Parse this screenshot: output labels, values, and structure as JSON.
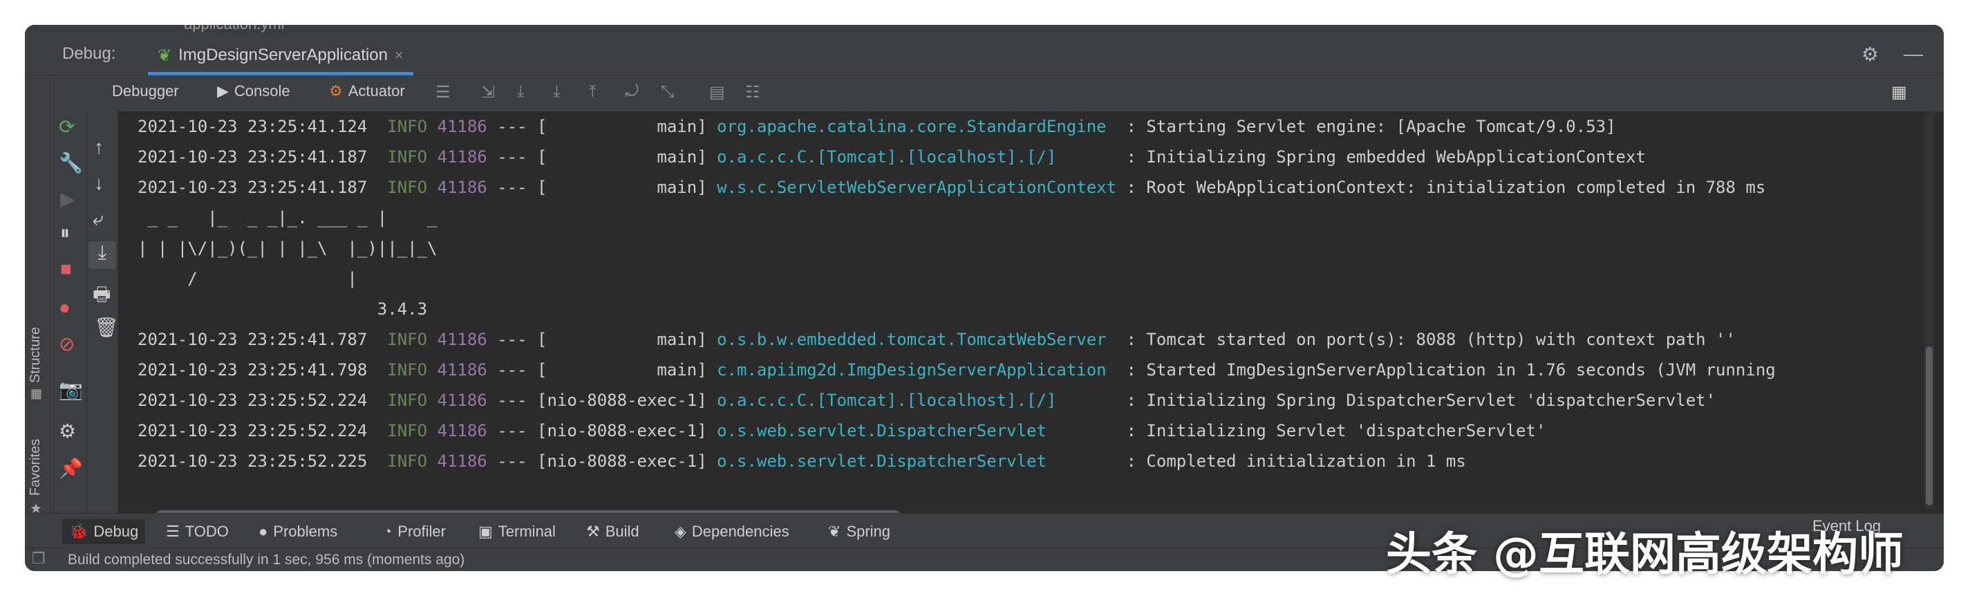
{
  "window": {
    "top_file": "application.yml",
    "debug_label": "Debug:",
    "run_config_tab": "ImgDesignServerApplication",
    "tab_close": "×"
  },
  "toolbar": {
    "debugger_label": "Debugger",
    "console_label": "Console",
    "actuator_label": "Actuator"
  },
  "left_sidebar": {
    "structure_label": "Structure",
    "favorites_label": "Favorites"
  },
  "console_lines": [
    {
      "ts": "2021-10-23 23:25:41.124",
      "level": "INFO",
      "pid": "41186",
      "sep": "---",
      "thread": "[           main]",
      "logger": "org.apache.catalina.core.StandardEngine ",
      "msg": ": Starting Servlet engine: [Apache Tomcat/9.0.53]"
    },
    {
      "ts": "2021-10-23 23:25:41.187",
      "level": "INFO",
      "pid": "41186",
      "sep": "---",
      "thread": "[           main]",
      "logger": "o.a.c.c.C.[Tomcat].[localhost].[/]      ",
      "msg": ": Initializing Spring embedded WebApplicationContext"
    },
    {
      "ts": "2021-10-23 23:25:41.187",
      "level": "INFO",
      "pid": "41186",
      "sep": "---",
      "thread": "[           main]",
      "logger": "w.s.c.ServletWebServerApplicationContext",
      "msg": ": Root WebApplicationContext: initialization completed in 788 ms"
    }
  ],
  "banner": {
    "line1": " _ _   |_  _ _|_. ___ _ |    _",
    "line2": "| | |\\/|_)(_| | |_\\  |_)||_|_\\",
    "line3": "     /               |",
    "version": "                        3.4.3"
  },
  "console_lines_after": [
    {
      "ts": "2021-10-23 23:25:41.787",
      "level": "INFO",
      "pid": "41186",
      "sep": "---",
      "thread": "[           main]",
      "logger": "o.s.b.w.embedded.tomcat.TomcatWebServer ",
      "msg": ": Tomcat started on port(s): 8088 (http) with context path ''"
    },
    {
      "ts": "2021-10-23 23:25:41.798",
      "level": "INFO",
      "pid": "41186",
      "sep": "---",
      "thread": "[           main]",
      "logger": "c.m.apiimg2d.ImgDesignServerApplication ",
      "msg": ": Started ImgDesignServerApplication in 1.76 seconds (JVM running"
    },
    {
      "ts": "2021-10-23 23:25:52.224",
      "level": "INFO",
      "pid": "41186",
      "sep": "---",
      "thread": "[nio-8088-exec-1]",
      "logger": "o.a.c.c.C.[Tomcat].[localhost].[/]      ",
      "msg": ": Initializing Spring DispatcherServlet 'dispatcherServlet'"
    },
    {
      "ts": "2021-10-23 23:25:52.224",
      "level": "INFO",
      "pid": "41186",
      "sep": "---",
      "thread": "[nio-8088-exec-1]",
      "logger": "o.s.web.servlet.DispatcherServlet       ",
      "msg": ": Initializing Servlet 'dispatcherServlet'"
    },
    {
      "ts": "2021-10-23 23:25:52.225",
      "level": "INFO",
      "pid": "41186",
      "sep": "---",
      "thread": "[nio-8088-exec-1]",
      "logger": "o.s.web.servlet.DispatcherServlet       ",
      "msg": ": Completed initialization in 1 ms"
    }
  ],
  "bottom_tabs": [
    "Debug",
    "TODO",
    "Problems",
    "Profiler",
    "Terminal",
    "Build",
    "Dependencies",
    "Spring"
  ],
  "event_log": "Event Log",
  "status": {
    "text": "Build completed successfully in 1 sec, 956 ms (moments ago)"
  },
  "watermark": "头条 @互联网高级架构师",
  "colors": {
    "background": "#2b2b2b",
    "panel": "#3c3f41",
    "info": "#6a8759",
    "pid": "#9876aa",
    "logger": "#3ab4c4",
    "tab_accent": "#4a88c7"
  }
}
